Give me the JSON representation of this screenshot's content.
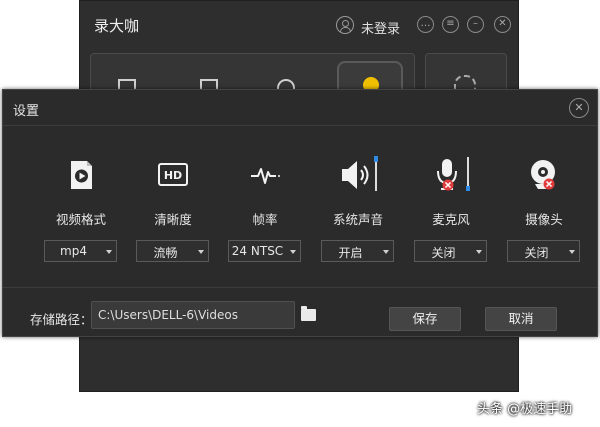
{
  "main_window": {
    "title": "录大咖",
    "login_status": "未登录"
  },
  "settings": {
    "title": "设置",
    "options": [
      {
        "label": "视频格式",
        "value": "mp4",
        "icon": "video-format-icon"
      },
      {
        "label": "清晰度",
        "value": "流畅",
        "icon": "hd-icon"
      },
      {
        "label": "帧率",
        "value": "24 NTSC",
        "icon": "waveform-icon"
      },
      {
        "label": "系统声音",
        "value": "开启",
        "icon": "speaker-icon"
      },
      {
        "label": "麦克风",
        "value": "关闭",
        "icon": "microphone-icon"
      },
      {
        "label": "摄像头",
        "value": "关闭",
        "icon": "camera-icon"
      }
    ],
    "path_label": "存储路径：",
    "path_value": "C:\\Users\\DELL-6\\Videos",
    "save_label": "保存",
    "cancel_label": "取消"
  },
  "colors": {
    "accent": "#2f8be6",
    "danger": "#e03c3c",
    "record": "#f0c000",
    "dialog_bg": "#2b2b2b"
  },
  "watermark": "头条 @极速手助"
}
